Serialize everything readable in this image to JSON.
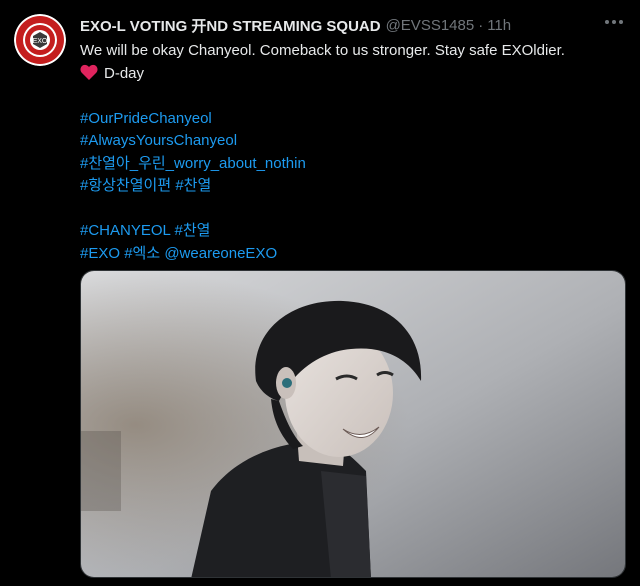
{
  "tweet": {
    "author_name": "EXO-L VOTING 开ND STREAMING SQUAD",
    "handle": "@EVSS1485",
    "separator": "·",
    "time": "11h",
    "text_line1": "We will be okay Chanyeol. Comeback to us stronger. Stay safe EXOldier.",
    "text_line2": "D-day",
    "hashtags_group1": [
      "#OurPrideChanyeol",
      "#AlwaysYoursChanyeol",
      "#찬열아_우린_worry_about_nothin"
    ],
    "hashtags_line4a": "#항상찬열이편",
    "hashtags_line4b": "#찬열",
    "hashtags_line5a": "#CHANYEOL",
    "hashtags_line5b": "#찬열",
    "hashtags_line6a": "#EXO",
    "hashtags_line6b": "#엑소",
    "mention": "@weareoneEXO"
  },
  "icons": {
    "avatar": "exo-l-logo-avatar",
    "more": "more-options-icon",
    "heart": "red-heart-emoji"
  },
  "colors": {
    "background": "#000000",
    "text": "#e7e9ea",
    "muted": "#71767b",
    "link": "#1d9bf0",
    "heart": "#e0245e"
  }
}
